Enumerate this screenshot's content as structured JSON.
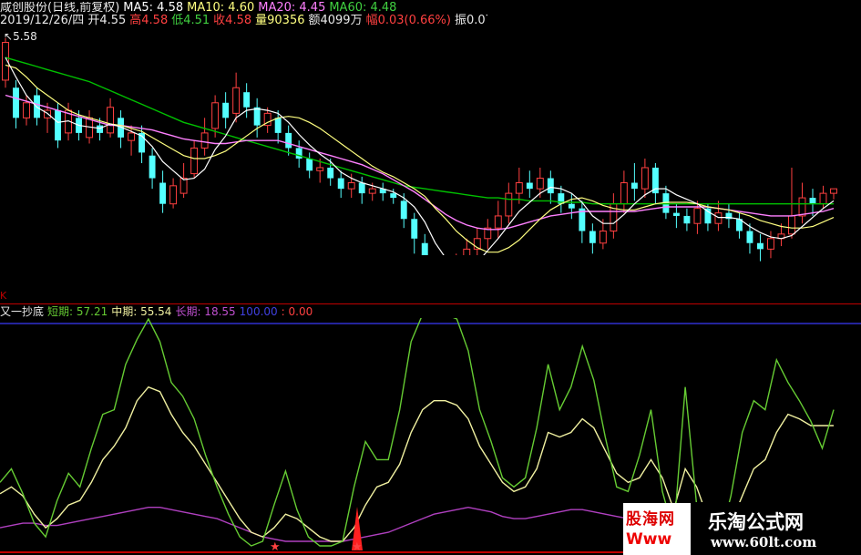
{
  "header": {
    "stock": "咸创股份(日线,前复权)",
    "ma5": "MA5: 4.58",
    "ma10": "MA10: 4.60",
    "ma20": "MA20: 4.45",
    "ma60": "MA60: 4.48",
    "date": "2019/12/26/四",
    "open": "开4.55",
    "high": "高4.58",
    "low": "低4.51",
    "close": "收4.58",
    "volume": "量90356",
    "amount": "额4099万",
    "change": "幅0.03(0.66%)",
    "amplitude": "振0.07",
    "max_price_label": "5.58",
    "panel_marker": "K"
  },
  "indicator": {
    "name": "又一抄底",
    "short_label": "短期: 57.21",
    "mid_label": "中期: 55.54",
    "long_label": "长期: 18.55",
    "level_label": "100.00",
    "zero_label": ": 0.00"
  },
  "watermarks": {
    "left_line1": "股海网",
    "left_line2": "Www",
    "right_line1": "乐淘公式网",
    "right_line2": "www.60lt.com"
  },
  "colors": {
    "bg": "#000000",
    "up": "#ff4040",
    "down": "#54ffff",
    "ma5": "#ffffff",
    "ma10": "#ffff80",
    "ma20": "#ff80ff",
    "ma60": "#00c000",
    "short": "#66cc33",
    "mid": "#f0f0a0",
    "long": "#b040c0",
    "level": "#3030d0",
    "separator": "#c00000"
  },
  "chart_data": [
    {
      "type": "candlestick",
      "title": "咸创股份(日线,前复权)",
      "series_order": [
        "open",
        "close",
        "high",
        "low"
      ],
      "y_range": [
        3.85,
        5.65
      ],
      "candles": [
        [
          5.3,
          5.55,
          5.58,
          5.25
        ],
        [
          5.25,
          5.05,
          5.3,
          4.98
        ],
        [
          5.05,
          5.15,
          5.2,
          5.0
        ],
        [
          5.2,
          5.05,
          5.25,
          5.0
        ],
        [
          5.05,
          5.1,
          5.15,
          4.95
        ],
        [
          5.1,
          4.9,
          5.15,
          4.85
        ],
        [
          4.95,
          5.1,
          5.15,
          4.9
        ],
        [
          5.05,
          4.95,
          5.1,
          4.9
        ],
        [
          4.92,
          5.05,
          5.1,
          4.88
        ],
        [
          5.0,
          4.95,
          5.05,
          4.9
        ],
        [
          4.95,
          5.12,
          5.18,
          4.92
        ],
        [
          5.05,
          4.92,
          5.1,
          4.85
        ],
        [
          4.9,
          4.95,
          5.0,
          4.8
        ],
        [
          4.95,
          4.82,
          5.0,
          4.75
        ],
        [
          4.8,
          4.65,
          4.85,
          4.58
        ],
        [
          4.62,
          4.48,
          4.7,
          4.42
        ],
        [
          4.48,
          4.6,
          4.65,
          4.45
        ],
        [
          4.55,
          4.65,
          4.75,
          4.52
        ],
        [
          4.68,
          4.85,
          4.9,
          4.65
        ],
        [
          4.85,
          4.95,
          5.05,
          4.8
        ],
        [
          4.98,
          5.15,
          5.2,
          4.92
        ],
        [
          5.15,
          5.05,
          5.22,
          4.98
        ],
        [
          5.08,
          5.25,
          5.35,
          5.02
        ],
        [
          5.22,
          5.12,
          5.28,
          5.05
        ],
        [
          5.12,
          5.0,
          5.18,
          4.92
        ],
        [
          5.0,
          5.08,
          5.12,
          4.95
        ],
        [
          5.05,
          4.95,
          5.1,
          4.88
        ],
        [
          4.95,
          4.85,
          5.0,
          4.8
        ],
        [
          4.85,
          4.78,
          4.9,
          4.72
        ],
        [
          4.78,
          4.7,
          4.82,
          4.65
        ],
        [
          4.7,
          4.72,
          4.78,
          4.62
        ],
        [
          4.72,
          4.65,
          4.78,
          4.6
        ],
        [
          4.65,
          4.58,
          4.7,
          4.52
        ],
        [
          4.58,
          4.62,
          4.68,
          4.52
        ],
        [
          4.62,
          4.55,
          4.66,
          4.48
        ],
        [
          4.55,
          4.58,
          4.62,
          4.5
        ],
        [
          4.58,
          4.55,
          4.62,
          4.5
        ],
        [
          4.55,
          4.52,
          4.58,
          4.48
        ],
        [
          4.5,
          4.38,
          4.55,
          4.32
        ],
        [
          4.38,
          4.25,
          4.42,
          4.15
        ],
        [
          4.22,
          4.05,
          4.28,
          3.95
        ],
        [
          4.05,
          3.92,
          4.1,
          3.85
        ],
        [
          3.95,
          4.02,
          4.1,
          3.9
        ],
        [
          4.02,
          4.08,
          4.15,
          3.95
        ],
        [
          4.08,
          4.18,
          4.25,
          4.02
        ],
        [
          4.18,
          4.25,
          4.32,
          4.1
        ],
        [
          4.25,
          4.32,
          4.38,
          4.18
        ],
        [
          4.32,
          4.4,
          4.5,
          4.25
        ],
        [
          4.4,
          4.55,
          4.62,
          4.35
        ],
        [
          4.55,
          4.62,
          4.72,
          4.48
        ],
        [
          4.62,
          4.58,
          4.7,
          4.52
        ],
        [
          4.58,
          4.65,
          4.72,
          4.52
        ],
        [
          4.65,
          4.55,
          4.7,
          4.48
        ],
        [
          4.55,
          4.48,
          4.6,
          4.42
        ],
        [
          4.48,
          4.45,
          4.55,
          4.38
        ],
        [
          4.45,
          4.3,
          4.5,
          4.22
        ],
        [
          4.3,
          4.22,
          4.35,
          4.15
        ],
        [
          4.22,
          4.3,
          4.38,
          4.18
        ],
        [
          4.3,
          4.48,
          4.55,
          4.25
        ],
        [
          4.48,
          4.62,
          4.7,
          4.42
        ],
        [
          4.62,
          4.58,
          4.75,
          4.5
        ],
        [
          4.58,
          4.72,
          4.78,
          4.52
        ],
        [
          4.72,
          4.55,
          4.75,
          4.48
        ],
        [
          4.55,
          4.42,
          4.6,
          4.38
        ],
        [
          4.42,
          4.4,
          4.48,
          4.32
        ],
        [
          4.4,
          4.35,
          4.45,
          4.3
        ],
        [
          4.35,
          4.45,
          4.5,
          4.28
        ],
        [
          4.45,
          4.35,
          4.48,
          4.3
        ],
        [
          4.35,
          4.42,
          4.5,
          4.3
        ],
        [
          4.42,
          4.38,
          4.48,
          4.32
        ],
        [
          4.38,
          4.3,
          4.42,
          4.25
        ],
        [
          4.3,
          4.22,
          4.35,
          4.15
        ],
        [
          4.22,
          4.18,
          4.28,
          4.1
        ],
        [
          4.18,
          4.25,
          4.3,
          4.12
        ],
        [
          4.25,
          4.28,
          4.35,
          4.2
        ],
        [
          4.28,
          4.4,
          4.72,
          4.25
        ],
        [
          4.4,
          4.52,
          4.62,
          4.35
        ],
        [
          4.52,
          4.48,
          4.58,
          4.4
        ],
        [
          4.48,
          4.55,
          4.6,
          4.45
        ],
        [
          4.55,
          4.58,
          4.58,
          4.51
        ]
      ],
      "ma5": [
        5.45,
        5.32,
        5.2,
        5.12,
        5.08,
        5.02,
        5.03,
        5.0,
        4.99,
        4.98,
        5.01,
        4.99,
        4.96,
        4.93,
        4.86,
        4.76,
        4.7,
        4.64,
        4.65,
        4.71,
        4.84,
        4.93,
        5.05,
        5.1,
        5.11,
        5.1,
        5.08,
        5.02,
        4.94,
        4.87,
        4.81,
        4.76,
        4.69,
        4.65,
        4.62,
        4.6,
        4.58,
        4.56,
        4.52,
        4.46,
        4.36,
        4.22,
        4.12,
        4.06,
        4.05,
        4.09,
        4.17,
        4.25,
        4.34,
        4.43,
        4.49,
        4.55,
        4.59,
        4.58,
        4.55,
        4.49,
        4.4,
        4.35,
        4.35,
        4.41,
        4.48,
        4.54,
        4.58,
        4.58,
        4.54,
        4.51,
        4.48,
        4.43,
        4.39,
        4.39,
        4.38,
        4.33,
        4.29,
        4.26,
        4.25,
        4.27,
        4.33,
        4.39,
        4.45,
        4.5
      ],
      "ma10": [
        5.4,
        5.38,
        5.32,
        5.25,
        5.2,
        5.15,
        5.1,
        5.07,
        5.05,
        5.03,
        5.01,
        5.0,
        4.98,
        4.96,
        4.92,
        4.88,
        4.84,
        4.8,
        4.78,
        4.78,
        4.8,
        4.83,
        4.88,
        4.93,
        4.98,
        5.02,
        5.05,
        5.06,
        5.05,
        5.02,
        4.98,
        4.93,
        4.88,
        4.83,
        4.78,
        4.73,
        4.69,
        4.66,
        4.62,
        4.58,
        4.53,
        4.45,
        4.38,
        4.3,
        4.24,
        4.19,
        4.16,
        4.16,
        4.19,
        4.24,
        4.31,
        4.38,
        4.44,
        4.48,
        4.51,
        4.52,
        4.5,
        4.47,
        4.45,
        4.44,
        4.44,
        4.46,
        4.48,
        4.49,
        4.49,
        4.49,
        4.48,
        4.46,
        4.45,
        4.44,
        4.42,
        4.4,
        4.37,
        4.35,
        4.33,
        4.32,
        4.32,
        4.33,
        4.36,
        4.39
      ],
      "ma20": [
        5.2,
        5.18,
        5.16,
        5.14,
        5.12,
        5.1,
        5.08,
        5.06,
        5.04,
        5.02,
        5.0,
        5.0,
        4.99,
        4.98,
        4.97,
        4.95,
        4.93,
        4.91,
        4.9,
        4.89,
        4.88,
        4.88,
        4.89,
        4.9,
        4.9,
        4.9,
        4.9,
        4.88,
        4.86,
        4.84,
        4.82,
        4.8,
        4.78,
        4.76,
        4.74,
        4.71,
        4.68,
        4.64,
        4.6,
        4.56,
        4.51,
        4.46,
        4.41,
        4.37,
        4.34,
        4.32,
        4.31,
        4.31,
        4.32,
        4.34,
        4.36,
        4.38,
        4.4,
        4.41,
        4.42,
        4.43,
        4.43,
        4.43,
        4.43,
        4.43,
        4.43,
        4.44,
        4.45,
        4.46,
        4.46,
        4.46,
        4.46,
        4.46,
        4.45,
        4.44,
        4.43,
        4.42,
        4.41,
        4.4,
        4.4,
        4.4,
        4.41,
        4.42,
        4.43,
        4.45
      ],
      "ma60": [
        5.45,
        5.43,
        5.41,
        5.39,
        5.37,
        5.35,
        5.33,
        5.31,
        5.29,
        5.26,
        5.23,
        5.2,
        5.17,
        5.14,
        5.11,
        5.08,
        5.05,
        5.02,
        5.0,
        4.98,
        4.96,
        4.94,
        4.92,
        4.9,
        4.88,
        4.86,
        4.84,
        4.82,
        4.8,
        4.78,
        4.76,
        4.74,
        4.72,
        4.7,
        4.68,
        4.66,
        4.64,
        4.62,
        4.6,
        4.59,
        4.58,
        4.57,
        4.56,
        4.55,
        4.54,
        4.53,
        4.52,
        4.52,
        4.51,
        4.51,
        4.5,
        4.5,
        4.5,
        4.49,
        4.49,
        4.49,
        4.48,
        4.48,
        4.48,
        4.48,
        4.48,
        4.48,
        4.48,
        4.48,
        4.48,
        4.48,
        4.48,
        4.48,
        4.48,
        4.48,
        4.48,
        4.48,
        4.48,
        4.48,
        4.48,
        4.48,
        4.48,
        4.48,
        4.48,
        4.48
      ]
    },
    {
      "type": "line",
      "title": "又一抄底",
      "y_range": [
        0,
        100
      ],
      "series": [
        {
          "name": "短期",
          "values": [
            30,
            36,
            25,
            12,
            6,
            22,
            34,
            28,
            45,
            60,
            62,
            82,
            93,
            102,
            92,
            74,
            68,
            58,
            42,
            28,
            16,
            6,
            2,
            4,
            20,
            35,
            18,
            6,
            2,
            2,
            4,
            28,
            48,
            40,
            40,
            62,
            92,
            104,
            104,
            104,
            102,
            88,
            62,
            48,
            32,
            28,
            32,
            54,
            82,
            62,
            72,
            90,
            75,
            50,
            28,
            26,
            42,
            62,
            26,
            8,
            72,
            20,
            2,
            4,
            24,
            52,
            66,
            62,
            84,
            74,
            66,
            57,
            45,
            62
          ]
        },
        {
          "name": "中期",
          "values": [
            25,
            28,
            24,
            16,
            10,
            14,
            20,
            22,
            30,
            40,
            46,
            54,
            66,
            72,
            70,
            60,
            52,
            46,
            38,
            30,
            22,
            14,
            8,
            6,
            10,
            16,
            14,
            10,
            6,
            4,
            4,
            10,
            20,
            28,
            30,
            38,
            52,
            62,
            66,
            66,
            64,
            58,
            46,
            38,
            30,
            26,
            28,
            36,
            52,
            50,
            52,
            58,
            54,
            44,
            34,
            30,
            32,
            40,
            32,
            18,
            36,
            28,
            14,
            8,
            12,
            24,
            36,
            40,
            52,
            60,
            58,
            55,
            55,
            55
          ]
        },
        {
          "name": "长期",
          "values": [
            10,
            11,
            12,
            12,
            11,
            11,
            12,
            13,
            14,
            15,
            16,
            17,
            18,
            19,
            19,
            18,
            17,
            16,
            15,
            14,
            12,
            10,
            8,
            6,
            5,
            4,
            4,
            4,
            4,
            4,
            4,
            5,
            6,
            7,
            8,
            10,
            12,
            14,
            16,
            17,
            18,
            19,
            18,
            17,
            15,
            14,
            14,
            15,
            16,
            17,
            18,
            18,
            17,
            16,
            15,
            14,
            14,
            14,
            14,
            13,
            13,
            12,
            11,
            11,
            11,
            12,
            13,
            14,
            15,
            16,
            17,
            18,
            18,
            18
          ]
        }
      ]
    }
  ]
}
